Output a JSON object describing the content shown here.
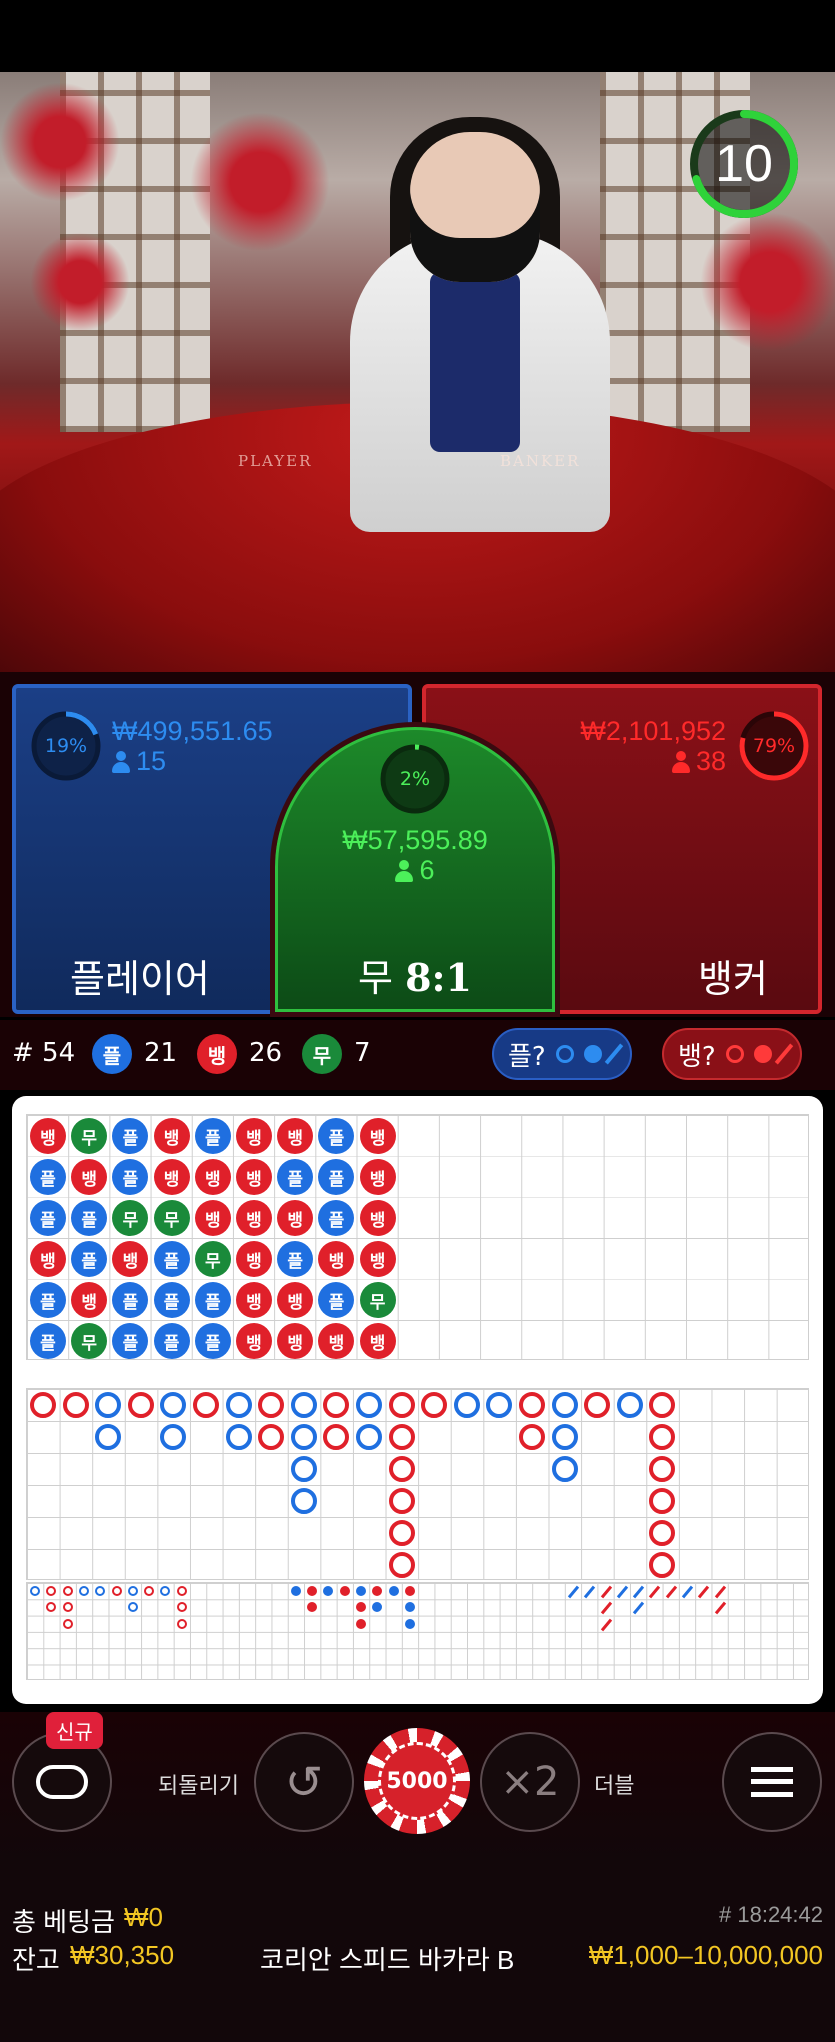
{
  "video": {
    "felt_player": "PLAYER",
    "felt_banker": "BANKER",
    "timer_value": "10",
    "timer_progress": 0.7
  },
  "bets": {
    "player": {
      "percent": "19%",
      "amount": "₩499,551.65",
      "bettors": "15",
      "label": "플레이어",
      "color": "#2d8cf0"
    },
    "tie": {
      "percent": "2%",
      "amount": "₩57,595.89",
      "bettors": "6",
      "label_main": "무",
      "label_odds": "8:1",
      "color": "#4cf05a"
    },
    "banker": {
      "percent": "79%",
      "amount": "₩2,101,952",
      "bettors": "38",
      "label": "뱅커",
      "color": "#ff2a2a"
    }
  },
  "stats": {
    "round_label": "# 54",
    "player_badge": "플",
    "player_count": "21",
    "banker_badge": "뱅",
    "banker_count": "26",
    "tie_badge": "무",
    "tie_count": "7",
    "player_predict": "플?",
    "banker_predict": "뱅?"
  },
  "bead_road": [
    [
      "뱅",
      "플",
      "플",
      "뱅",
      "플",
      "플"
    ],
    [
      "무",
      "뱅",
      "플",
      "플",
      "뱅",
      "무"
    ],
    [
      "플",
      "플",
      "무",
      "뱅",
      "플",
      "플"
    ],
    [
      "뱅",
      "뱅",
      "무",
      "플",
      "플",
      "플"
    ],
    [
      "플",
      "뱅",
      "뱅",
      "무",
      "플",
      "플"
    ],
    [
      "뱅",
      "뱅",
      "뱅",
      "뱅",
      "뱅",
      "뱅"
    ],
    [
      "뱅",
      "플",
      "뱅",
      "플",
      "뱅",
      "뱅"
    ],
    [
      "플",
      "플",
      "플",
      "뱅",
      "플",
      "뱅"
    ],
    [
      "뱅",
      "뱅",
      "뱅",
      "뱅",
      "무",
      "뱅"
    ]
  ],
  "controls": {
    "new_badge": "신규",
    "undo_label": "되돌리기",
    "chip_value": "5000",
    "double_symbol": "×2",
    "double_label": "더블"
  },
  "footer": {
    "total_bet_label": "총 베팅금",
    "total_bet_value": "₩0",
    "round_time": "# 18:24:42",
    "balance_label": "잔고",
    "balance_value": "₩30,350",
    "table_name": "코리안 스피드 바카라 B",
    "limits": "₩1,000–10,000,000"
  },
  "colors": {
    "player": "#1f6fe0",
    "banker": "#e0202a",
    "tie": "#1a8a3a",
    "gold": "#f3c623"
  }
}
